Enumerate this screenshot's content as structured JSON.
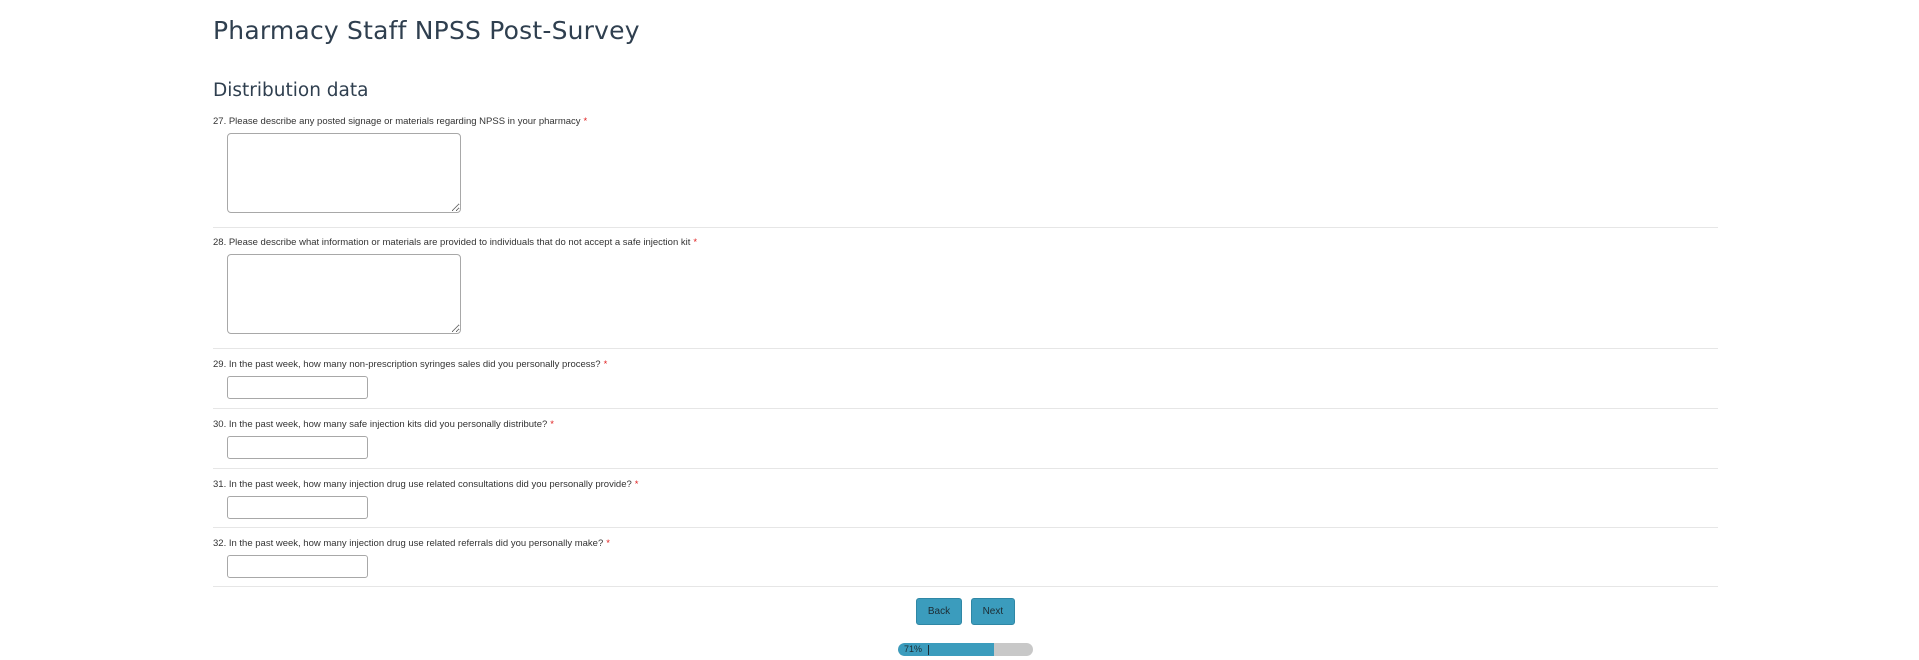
{
  "page": {
    "title": "Pharmacy Staff NPSS Post-Survey",
    "section_title": "Distribution data"
  },
  "questions": [
    {
      "label": "27. Please describe any posted signage or materials regarding NPSS in your pharmacy",
      "required_mark": "*",
      "type": "textarea",
      "value": ""
    },
    {
      "label": "28. Please describe what information or materials are provided to individuals that do not accept a safe injection kit",
      "required_mark": "*",
      "type": "textarea",
      "value": ""
    },
    {
      "label": "29. In the past week, how many non-prescription syringes sales did you personally process?",
      "required_mark": "*",
      "type": "text",
      "value": ""
    },
    {
      "label": "30. In the past week, how many safe injection kits did you personally distribute?",
      "required_mark": "*",
      "type": "text",
      "value": ""
    },
    {
      "label": "31. In the past week, how many injection drug use related consultations did you personally provide?",
      "required_mark": "*",
      "type": "text",
      "value": ""
    },
    {
      "label": "32. In the past week, how many injection drug use related referrals did you personally make?",
      "required_mark": "*",
      "type": "text",
      "value": ""
    }
  ],
  "navigation": {
    "back_label": "Back",
    "next_label": "Next"
  },
  "progress": {
    "percent": 71,
    "label": "71%"
  },
  "colors": {
    "accent": "#3b9cbd",
    "required": "#e02020",
    "title": "#2f3f4f",
    "progress_track": "#c8c8c8"
  }
}
